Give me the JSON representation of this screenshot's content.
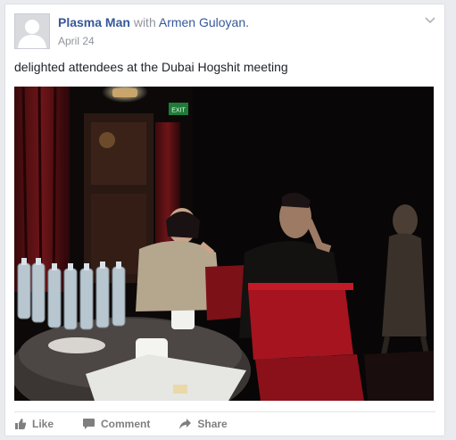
{
  "post": {
    "author": "Plasma Man",
    "with_label": "with",
    "tagged_person": "Armen Guloyan",
    "tagged_suffix": ".",
    "date": "April 24",
    "text": "delighted attendees at the Dubai Hogshit meeting",
    "photo_description": "",
    "exit_sign": "EXIT"
  },
  "actions": {
    "like": "Like",
    "comment": "Comment",
    "share": "Share"
  },
  "colors": {
    "link": "#365899",
    "muted": "#90949c",
    "action_gray": "#7f7f7f",
    "background": "#e9ebee"
  },
  "icons": {
    "avatar": "default-profile-silhouette-icon",
    "menu": "chevron-down-icon",
    "like": "thumbs-up-icon",
    "comment": "speech-bubble-icon",
    "share": "share-arrow-icon"
  }
}
